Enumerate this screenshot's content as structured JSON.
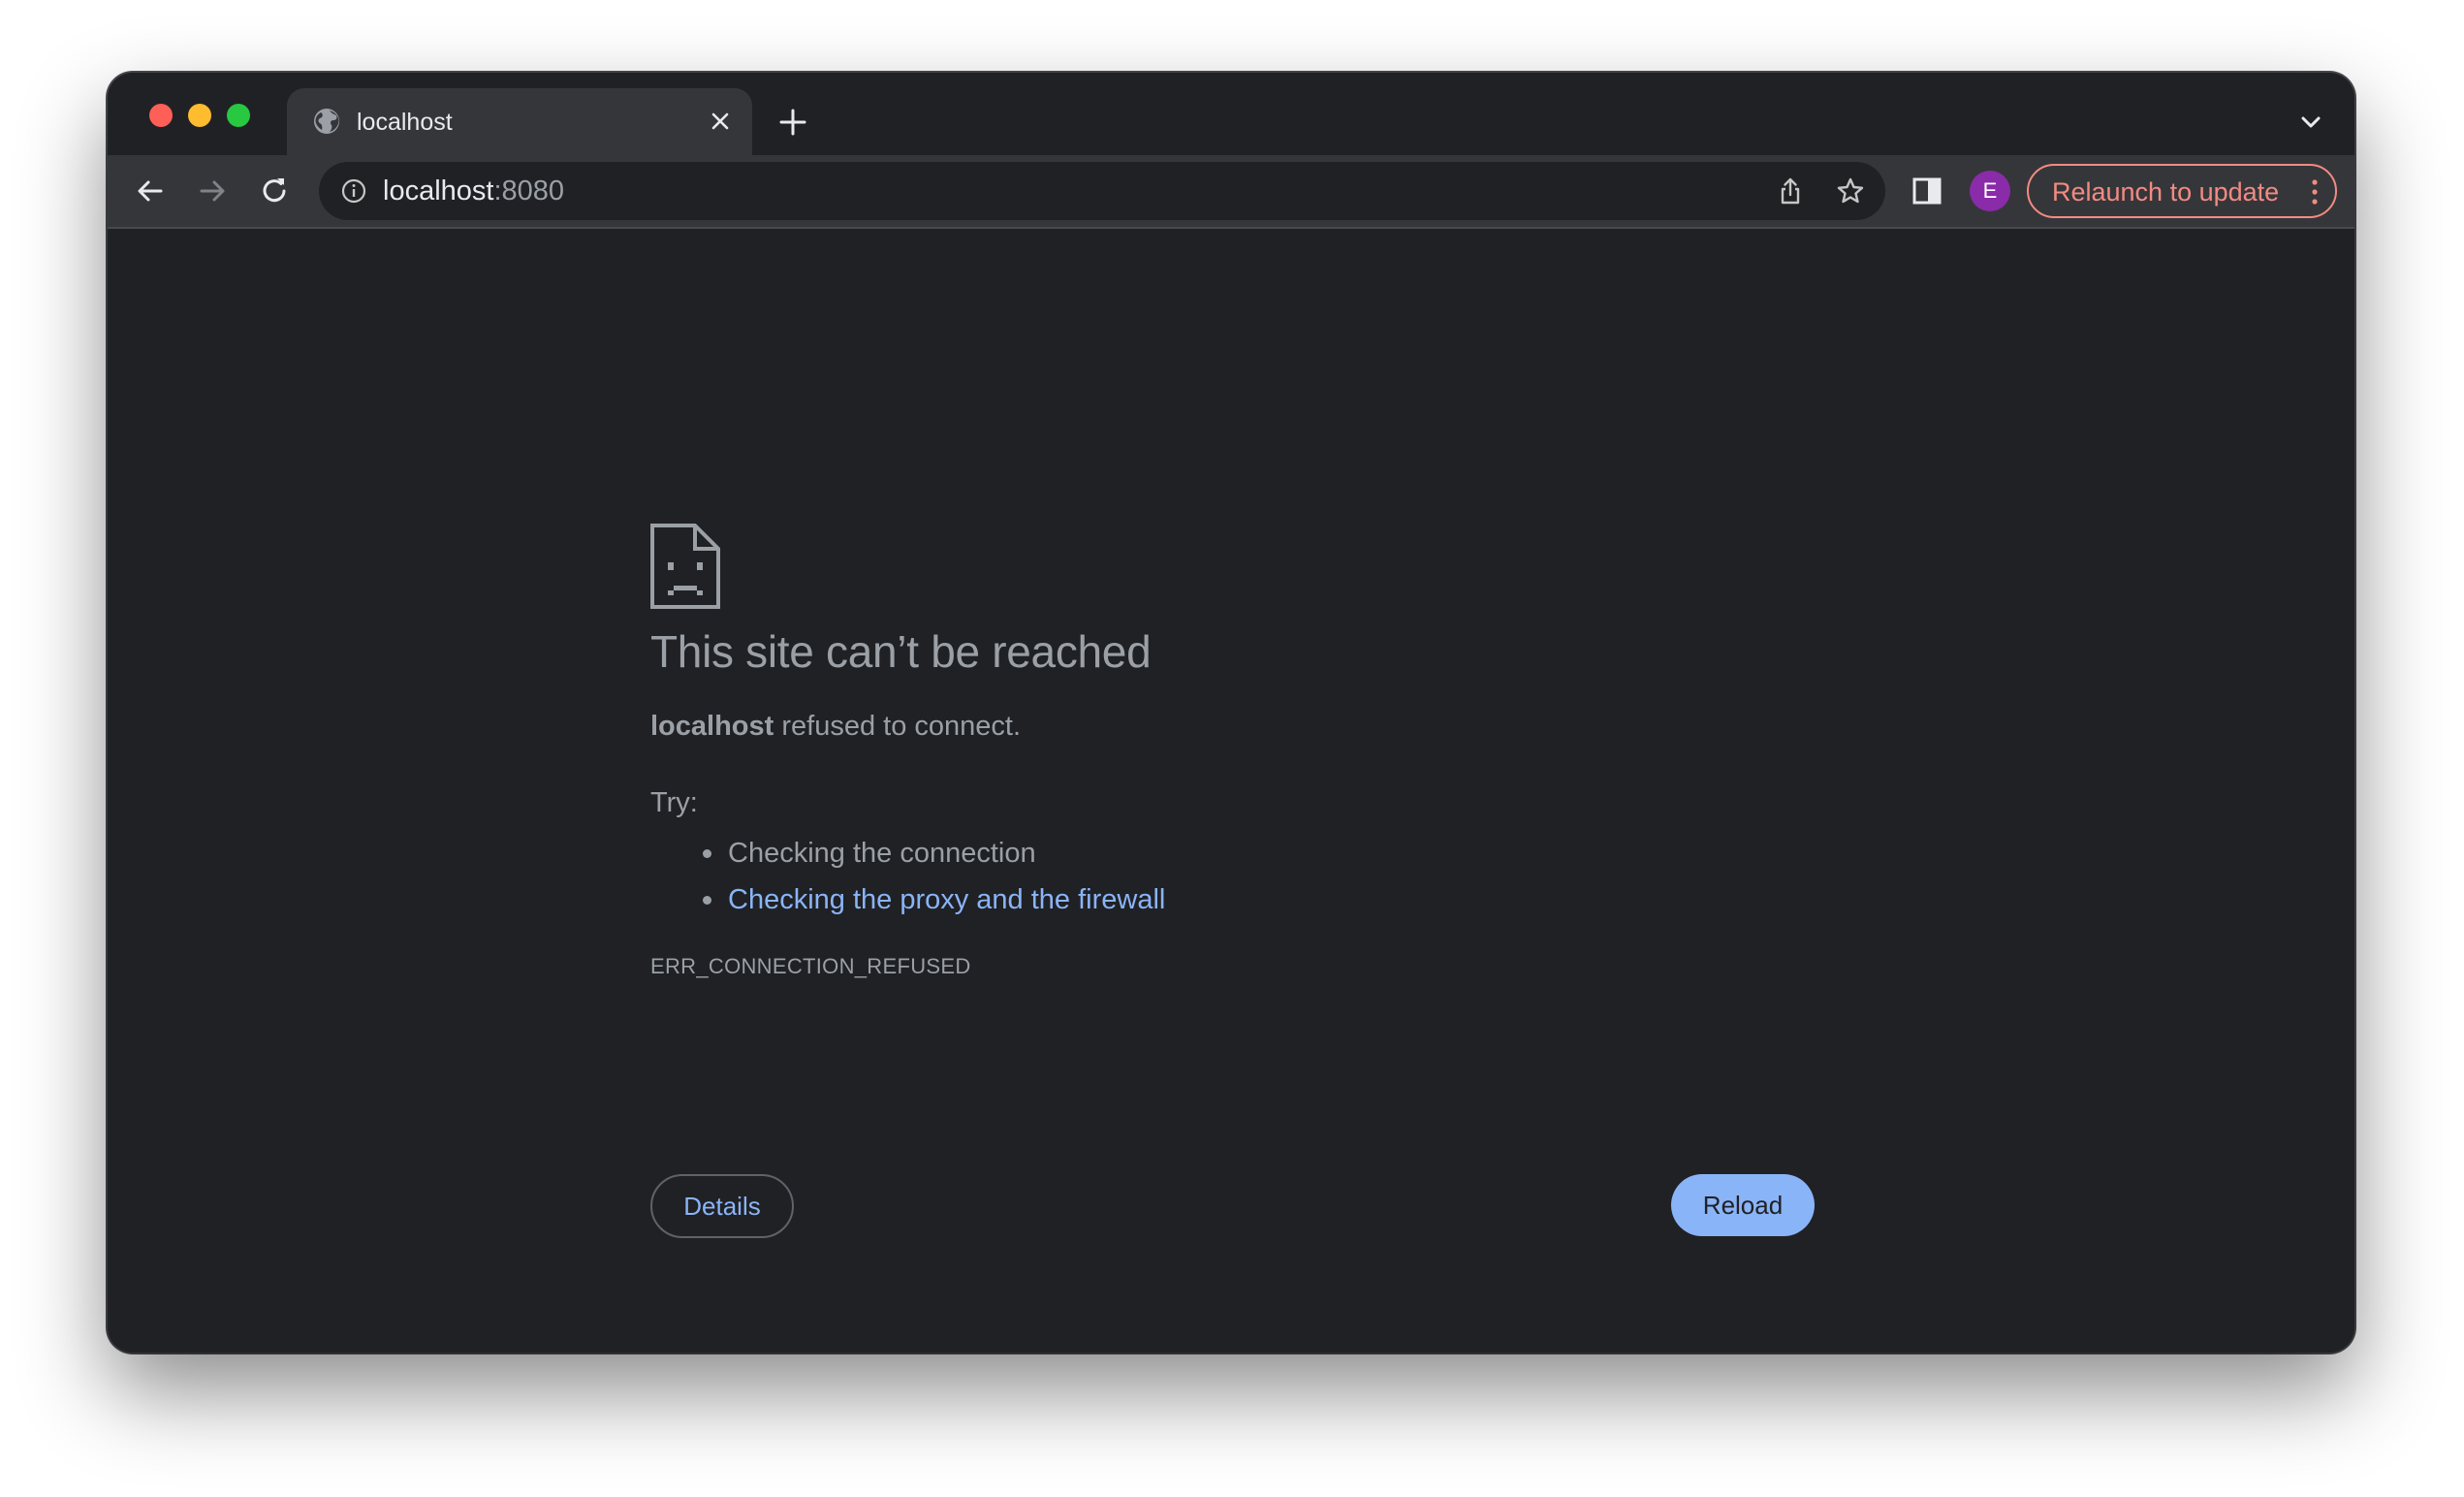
{
  "browser": {
    "tab": {
      "title": "localhost",
      "favicon": "globe-icon",
      "close": "close-icon"
    },
    "new_tab": "plus-icon",
    "tab_search": "chevron-down-icon",
    "toolbar": {
      "back": "arrow-left-icon",
      "forward": "arrow-right-icon",
      "reload": "reload-icon",
      "omnibox": {
        "host": "localhost",
        "port": ":8080",
        "info_icon": "info-icon",
        "share_icon": "share-icon",
        "bookmark_icon": "star-icon"
      },
      "side_panel": "side-panel-icon",
      "profile_initial": "E",
      "profile_color": "#8a2ba9",
      "relaunch_label": "Relaunch to update",
      "relaunch_color": "#f28b82",
      "menu_icon": "kebab-menu-icon"
    }
  },
  "error_page": {
    "icon": "sad-page-icon",
    "title": "This site can’t be reached",
    "host": "localhost",
    "message_rest": " refused to connect.",
    "try_label": "Try:",
    "suggestions": [
      {
        "text": "Checking the connection",
        "link": false
      },
      {
        "text": "Checking the proxy and the firewall",
        "link": true
      }
    ],
    "error_code": "ERR_CONNECTION_REFUSED",
    "details_label": "Details",
    "reload_label": "Reload",
    "accent_color": "#8ab4f8"
  }
}
